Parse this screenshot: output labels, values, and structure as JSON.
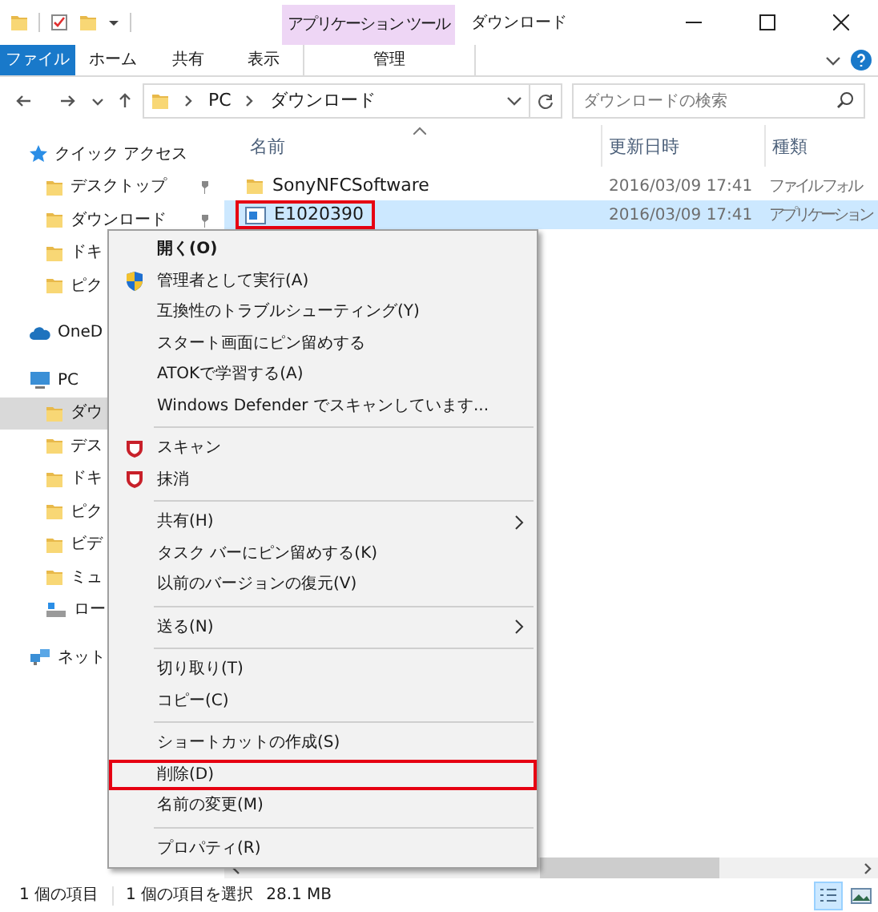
{
  "window": {
    "title": "ダウンロード",
    "context_tab_group": "アプリケーション ツール"
  },
  "ribbon": {
    "tabs": [
      {
        "label": "ファイル",
        "kind": "file",
        "selected": false
      },
      {
        "label": "ホーム",
        "kind": "tab",
        "selected": false
      },
      {
        "label": "共有",
        "kind": "tab",
        "selected": false
      },
      {
        "label": "表示",
        "kind": "tab",
        "selected": false
      },
      {
        "label": "管理",
        "kind": "context",
        "selected": false
      }
    ]
  },
  "address_bar": {
    "path": [
      "PC",
      "ダウンロード"
    ]
  },
  "search": {
    "placeholder": "ダウンロードの検索"
  },
  "sidebar": {
    "items": [
      {
        "label": "クイック アクセス",
        "kind": "star",
        "selected": false,
        "children": [
          {
            "label": "デスクトップ",
            "kind": "folder",
            "selected": false,
            "pinned": true
          },
          {
            "label": "ダウンロード",
            "kind": "folder",
            "selected": false,
            "pinned": true
          },
          {
            "label": "ドキ",
            "kind": "folder",
            "selected": false
          },
          {
            "label": "ピク",
            "kind": "folder",
            "selected": false
          }
        ]
      },
      {
        "label": "OneD",
        "kind": "cloud",
        "selected": false
      },
      {
        "label": "PC",
        "kind": "pc",
        "selected": false,
        "children": [
          {
            "label": "ダウ",
            "kind": "folder",
            "selected": true
          },
          {
            "label": "デス",
            "kind": "folder",
            "selected": false
          },
          {
            "label": "ドキ",
            "kind": "folder",
            "selected": false
          },
          {
            "label": "ピク",
            "kind": "folder",
            "selected": false
          },
          {
            "label": "ビデ",
            "kind": "folder",
            "selected": false
          },
          {
            "label": "ミュ",
            "kind": "folder",
            "selected": false
          },
          {
            "label": "ロー",
            "kind": "drive",
            "selected": false
          }
        ]
      },
      {
        "label": "ネット",
        "kind": "network",
        "selected": false
      }
    ]
  },
  "file_list": {
    "columns": [
      "名前",
      "更新日時",
      "種類"
    ],
    "rows": [
      {
        "name": "SonyNFCSoftware",
        "kind": "folder",
        "modified": "2016/03/09 17:41",
        "type": "ファイル フォル",
        "selected": false,
        "highlighted": false
      },
      {
        "name": "E1020390",
        "kind": "application",
        "modified": "2016/03/09 17:41",
        "type": "アプリケーション",
        "selected": true,
        "highlighted": true
      }
    ]
  },
  "context_menu": {
    "items": [
      {
        "kind": "item",
        "label": "開く(O)",
        "default": true,
        "submenu": false,
        "highlighted": false
      },
      {
        "kind": "admin_item",
        "label": "管理者として実行(A)",
        "default": false,
        "submenu": false,
        "highlighted": false
      },
      {
        "kind": "item",
        "label": "互換性のトラブルシューティング(Y)",
        "default": false,
        "submenu": false,
        "highlighted": false
      },
      {
        "kind": "item",
        "label": "スタート画面にピン留めする",
        "default": false,
        "submenu": false,
        "highlighted": false
      },
      {
        "kind": "item",
        "label": "ATOKで学習する(A)",
        "default": false,
        "submenu": false,
        "highlighted": false
      },
      {
        "kind": "item",
        "label": "Windows Defender でスキャンしています...",
        "default": false,
        "submenu": false,
        "highlighted": false
      },
      {
        "kind": "separator"
      },
      {
        "kind": "scan_item",
        "label": "スキャン",
        "default": false,
        "submenu": false,
        "highlighted": false
      },
      {
        "kind": "scan_item",
        "label": "抹消",
        "default": false,
        "submenu": false,
        "highlighted": false
      },
      {
        "kind": "separator"
      },
      {
        "kind": "item",
        "label": "共有(H)",
        "default": false,
        "submenu": true,
        "highlighted": false
      },
      {
        "kind": "item",
        "label": "タスク バーにピン留めする(K)",
        "default": false,
        "submenu": false,
        "highlighted": false
      },
      {
        "kind": "item",
        "label": "以前のバージョンの復元(V)",
        "default": false,
        "submenu": false,
        "highlighted": false
      },
      {
        "kind": "separator"
      },
      {
        "kind": "item",
        "label": "送る(N)",
        "default": false,
        "submenu": true,
        "highlighted": false
      },
      {
        "kind": "separator"
      },
      {
        "kind": "item",
        "label": "切り取り(T)",
        "default": false,
        "submenu": false,
        "highlighted": false
      },
      {
        "kind": "item",
        "label": "コピー(C)",
        "default": false,
        "submenu": false,
        "highlighted": false
      },
      {
        "kind": "separator"
      },
      {
        "kind": "item",
        "label": "ショートカットの作成(S)",
        "default": false,
        "submenu": false,
        "highlighted": false
      },
      {
        "kind": "item",
        "label": "削除(D)",
        "default": false,
        "submenu": false,
        "highlighted": true
      },
      {
        "kind": "item",
        "label": "名前の変更(M)",
        "default": false,
        "submenu": false,
        "highlighted": false
      },
      {
        "kind": "separator"
      },
      {
        "kind": "item",
        "label": "プロパティ(R)",
        "default": false,
        "submenu": false,
        "highlighted": false
      }
    ]
  },
  "status_bar": {
    "item_count": "1 個の項目",
    "selection": "1 個の項目を選択",
    "size": "28.1 MB",
    "views": [
      {
        "kind": "details",
        "selected": true
      },
      {
        "kind": "thumbnails",
        "selected": false
      }
    ]
  }
}
